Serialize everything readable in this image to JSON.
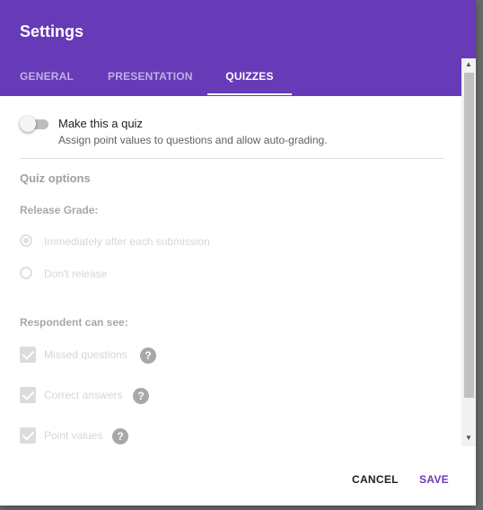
{
  "dialog": {
    "title": "Settings"
  },
  "tabs": [
    {
      "label": "GENERAL",
      "active": false
    },
    {
      "label": "PRESENTATION",
      "active": false
    },
    {
      "label": "QUIZZES",
      "active": true
    }
  ],
  "quiz_toggle": {
    "label": "Make this a quiz",
    "description": "Assign point values to questions and allow auto-grading.",
    "enabled": false
  },
  "quiz_options": {
    "title": "Quiz options",
    "release_grade": {
      "label": "Release Grade:",
      "options": [
        {
          "label": "Immediately after each submission",
          "selected": true
        },
        {
          "label": "Don't release",
          "selected": false
        }
      ]
    },
    "respondent_can_see": {
      "label": "Respondent can see:",
      "options": [
        {
          "label": "Missed questions",
          "checked": true,
          "help": "?"
        },
        {
          "label": "Correct answers",
          "checked": true,
          "help": "?"
        },
        {
          "label": "Point values",
          "checked": true,
          "help": "?"
        }
      ]
    }
  },
  "scrollbar": {
    "up": "▲",
    "down": "▼"
  },
  "actions": {
    "cancel_label": "CANCEL",
    "save_label": "SAVE"
  },
  "colors": {
    "accent": "#673ab7",
    "disabled_text": "#d6d6d6"
  }
}
